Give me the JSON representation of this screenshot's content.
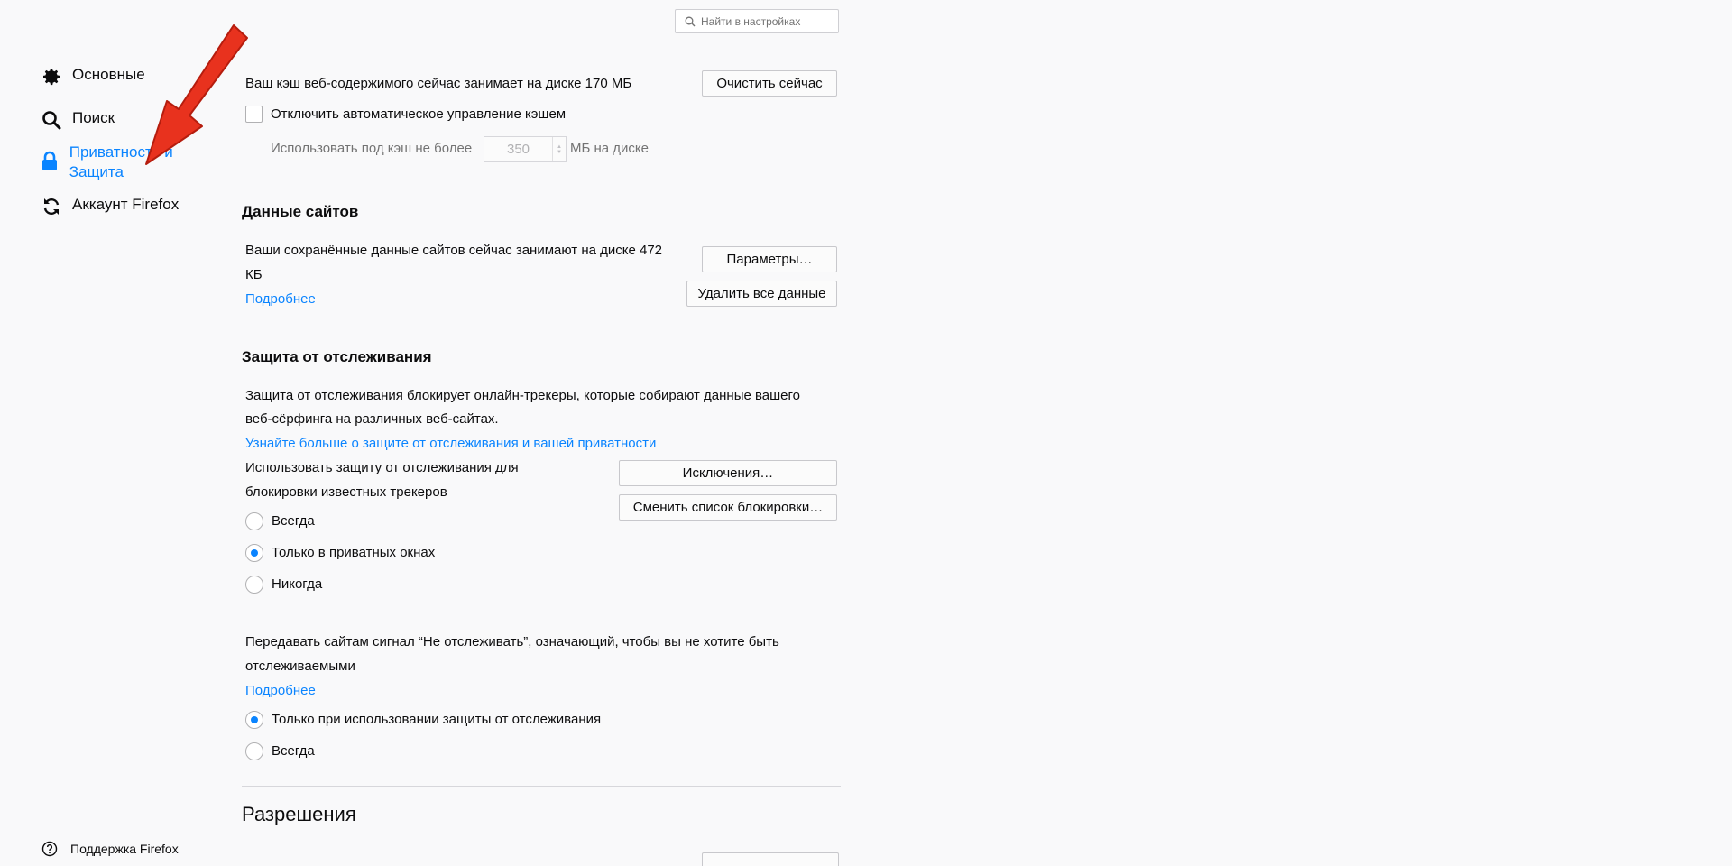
{
  "search": {
    "placeholder": "Найти в настройках"
  },
  "sidebar": {
    "items": [
      {
        "label": "Основные",
        "icon": "gear-icon"
      },
      {
        "label": "Поиск",
        "icon": "search-icon"
      },
      {
        "label": "Приватность и Защита",
        "icon": "lock-icon",
        "active": true
      },
      {
        "label": "Аккаунт Firefox",
        "icon": "sync-icon"
      }
    ],
    "support": {
      "label": "Поддержка Firefox",
      "icon": "help-icon"
    }
  },
  "cache": {
    "usage_text": "Ваш кэш веб-содержимого сейчас занимает на диске 170 МБ",
    "clear_button": "Очистить сейчас",
    "override_label": "Отключить автоматическое управление кэшем",
    "override_checked": false,
    "limit_prefix": "Использовать под кэш не более",
    "limit_value": "350",
    "limit_suffix": "МБ на диске"
  },
  "site_data": {
    "heading": "Данные сайтов",
    "usage_line1": "Ваши сохранённые данные сайтов сейчас занимают на диске 472",
    "usage_line2": "КБ",
    "learn_more": "Подробнее",
    "settings_button": "Параметры…",
    "clear_all_button": "Удалить все данные"
  },
  "tracking": {
    "heading": "Защита от отслеживания",
    "desc_line1": "Защита от отслеживания блокирует онлайн-трекеры, которые собирают данные вашего",
    "desc_line2": "веб-сёрфинга на различных веб-сайтах.",
    "learn_more": "Узнайте больше о защите от отслеживания и вашей приватности",
    "use_line1": "Использовать защиту от отслеживания для",
    "use_line2": "блокировки известных трекеров",
    "exceptions_button": "Исключения…",
    "change_list_button": "Сменить список блокировки…",
    "options": [
      {
        "label": "Всегда",
        "checked": false
      },
      {
        "label": "Только в приватных окнах",
        "checked": true
      },
      {
        "label": "Никогда",
        "checked": false
      }
    ]
  },
  "dnt": {
    "desc_line1": "Передавать сайтам сигнал “Не отслеживать”, означающий, чтобы вы не хотите быть",
    "desc_line2": "отслеживаемыми",
    "learn_more": "Подробнее",
    "options": [
      {
        "label": "Только при использовании защиты от отслеживания",
        "checked": true
      },
      {
        "label": "Всегда",
        "checked": false
      }
    ]
  },
  "permissions": {
    "heading": "Разрешения"
  },
  "colors": {
    "accent": "#0a84ff",
    "annotation_arrow": "#e8321e"
  }
}
